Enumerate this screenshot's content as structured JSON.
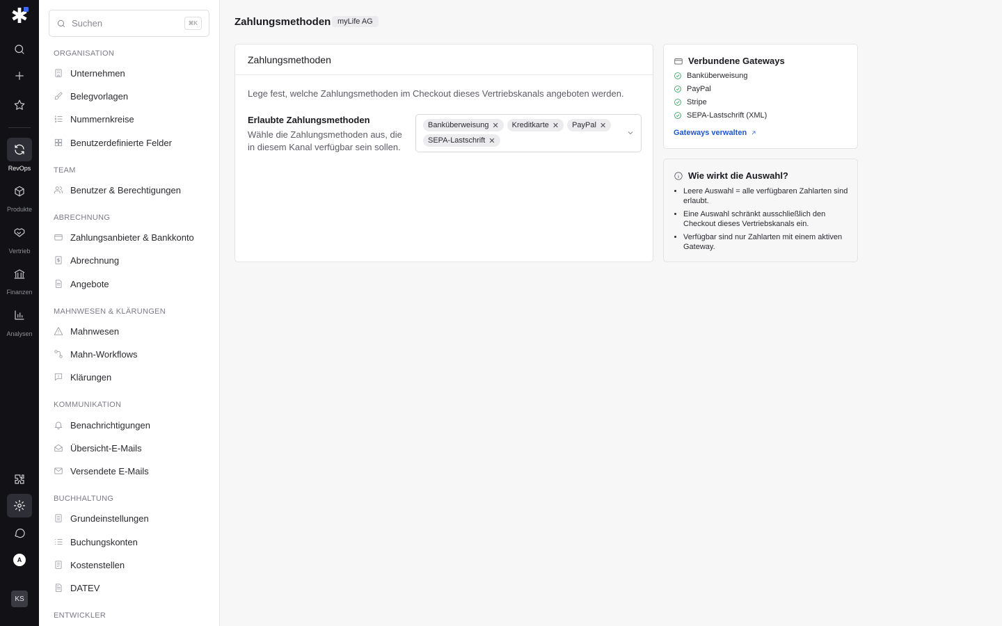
{
  "rail": {
    "items": [
      {
        "label": "RevOps"
      },
      {
        "label": "Produkte"
      },
      {
        "label": "Vertrieb"
      },
      {
        "label": "Finanzen"
      },
      {
        "label": "Analysen"
      }
    ],
    "avatar_a": "A",
    "avatar_user": "KS"
  },
  "sidebar": {
    "search_placeholder": "Suchen",
    "search_shortcut": "⌘K",
    "sections": [
      {
        "title": "Organisation",
        "items": [
          "Unternehmen",
          "Belegvorlagen",
          "Nummernkreise",
          "Benutzerdefinierte Felder"
        ]
      },
      {
        "title": "Team",
        "items": [
          "Benutzer & Berechtigungen"
        ]
      },
      {
        "title": "Abrechnung",
        "items": [
          "Zahlungsanbieter & Bankkonto",
          "Abrechnung",
          "Angebote"
        ]
      },
      {
        "title": "Mahnwesen & Klärungen",
        "items": [
          "Mahnwesen",
          "Mahn-Workflows",
          "Klärungen"
        ]
      },
      {
        "title": "Kommunikation",
        "items": [
          "Benachrichtigungen",
          "Übersicht-E-Mails",
          "Versendete E-Mails"
        ]
      },
      {
        "title": "Buchhaltung",
        "items": [
          "Grundeinstellungen",
          "Buchungskonten",
          "Kostenstellen",
          "DATEV"
        ]
      },
      {
        "title": "Entwickler",
        "items": []
      }
    ]
  },
  "main": {
    "title": "Zahlungsmethoden",
    "org_badge": "myLife AG",
    "card_title": "Zahlungsmethoden",
    "description": "Lege fest, welche Zahlungsmethoden im Checkout dieses Vertriebskanals angeboten werden.",
    "field_label": "Erlaubte Zahlungsmethoden",
    "field_help": "Wähle die Zahlungsmethoden aus, die in diesem Kanal verfügbar sein sollen.",
    "selected_methods": [
      "Banküberweisung",
      "Kreditkarte",
      "PayPal",
      "SEPA-Lastschrift"
    ]
  },
  "gateways": {
    "title": "Verbundene Gateways",
    "items": [
      "Banküberweisung",
      "PayPal",
      "Stripe",
      "SEPA-Lastschrift (XML)"
    ],
    "manage_link": "Gateways verwalten"
  },
  "info": {
    "title": "Wie wirkt die Auswahl?",
    "points": [
      "Leere Auswahl = alle verfügbaren Zahlarten sind erlaubt.",
      "Eine Auswahl schränkt ausschließlich den Checkout dieses Vertriebskanals ein.",
      "Verfügbar sind nur Zahlarten mit einem aktiven Gateway."
    ]
  }
}
